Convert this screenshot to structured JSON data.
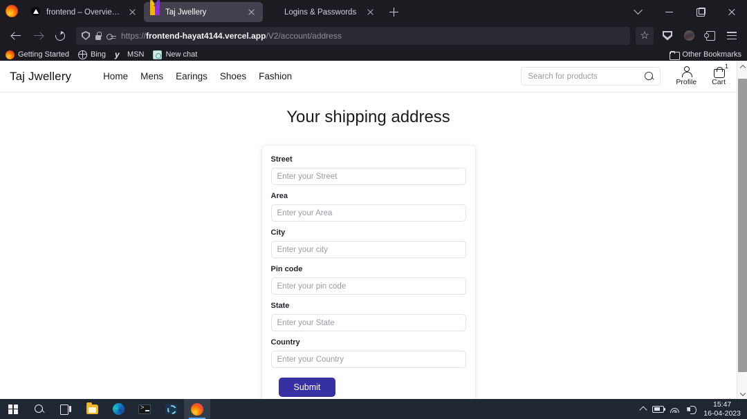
{
  "browser": {
    "tabs": [
      {
        "title": "frontend – Overview - Vercel",
        "icon": "vercel-triangle-icon",
        "active": false
      },
      {
        "title": "Taj Jwellery",
        "icon": "taj-jwellery-icon",
        "active": true
      },
      {
        "title": "Logins & Passwords",
        "icon": "firefox-icon",
        "active": false
      }
    ],
    "new_tab_label": "+",
    "window_controls": {
      "list_all_tabs": "chevron-down-icon",
      "minimize": "minimize-icon",
      "maximize": "maximize-icon",
      "close": "close-icon"
    },
    "toolbar": {
      "back": "back-arrow-icon",
      "forward": "forward-arrow-icon",
      "reload": "reload-icon",
      "url_scheme": "https://",
      "url_host": "frontend-hayat4144.vercel.app",
      "url_path": "/V2/account/address",
      "url_full": "https://frontend-hayat4144.vercel.app/V2/account/address",
      "bookmark_star": "☆",
      "pocket": "pocket-icon",
      "account": "avatar-icon",
      "extensions": "extensions-icon",
      "app_menu": "hamburger-menu-icon"
    },
    "bookmarks": [
      {
        "label": "Getting Started",
        "icon": "firefox-icon"
      },
      {
        "label": "Bing",
        "icon": "bing-globe-icon"
      },
      {
        "label": "MSN",
        "icon": "msn-icon"
      },
      {
        "label": "New chat",
        "icon": "new-chat-icon"
      }
    ],
    "other_bookmarks": {
      "label": "Other Bookmarks",
      "icon": "folder-icon"
    }
  },
  "site": {
    "brand": "Taj Jwellery",
    "nav": [
      {
        "label": "Home"
      },
      {
        "label": "Mens"
      },
      {
        "label": "Earings"
      },
      {
        "label": "Shoes"
      },
      {
        "label": "Fashion"
      }
    ],
    "search": {
      "placeholder": "Search for products",
      "value": ""
    },
    "profile": {
      "label": "Profile",
      "icon": "person-icon"
    },
    "cart": {
      "label": "Cart",
      "icon": "shopping-bag-icon",
      "badge": "1"
    }
  },
  "main": {
    "title": "Your shipping address",
    "form": {
      "fields": [
        {
          "label": "Street",
          "placeholder": "Enter your Street",
          "value": ""
        },
        {
          "label": "Area",
          "placeholder": "Enter your Area",
          "value": ""
        },
        {
          "label": "City",
          "placeholder": "Enter your city",
          "value": ""
        },
        {
          "label": "Pin code",
          "placeholder": "Enter your pin code",
          "value": ""
        },
        {
          "label": "State",
          "placeholder": "Enter your State",
          "value": ""
        },
        {
          "label": "Country",
          "placeholder": "Enter your Country",
          "value": ""
        }
      ],
      "submit_label": "Submit",
      "submit_color": "#3730a3"
    }
  },
  "taskbar": {
    "items": [
      {
        "name": "start-button",
        "icon": "windows-logo-icon"
      },
      {
        "name": "search-button",
        "icon": "search-icon"
      },
      {
        "name": "task-view-button",
        "icon": "task-view-icon"
      },
      {
        "name": "file-explorer",
        "icon": "file-explorer-icon"
      },
      {
        "name": "microsoft-edge",
        "icon": "edge-icon"
      },
      {
        "name": "terminal",
        "icon": "terminal-icon"
      },
      {
        "name": "settings",
        "icon": "settings-icon"
      },
      {
        "name": "firefox",
        "icon": "firefox-icon"
      }
    ],
    "tray": {
      "show_hidden": "chevron-up-icon",
      "battery": "battery-icon",
      "network": "wifi-icon",
      "volume": "volume-icon",
      "time": "15:47",
      "date": "16-04-2023"
    }
  }
}
